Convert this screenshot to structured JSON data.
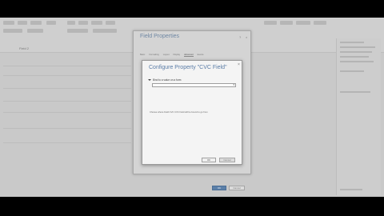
{
  "background_app": {
    "file_label": "Field 2",
    "left_section_labels": [
      "",
      "",
      "",
      ""
    ]
  },
  "field_properties": {
    "title": "Field Properties",
    "close_glyph": "×",
    "help_glyph": "?",
    "tabs": [
      "Basic",
      "Formatting",
      "Layout",
      "Display",
      "Advanced",
      "Events"
    ],
    "active_tab_index": 4,
    "ok_label": "OK",
    "cancel_label": "Cancel"
  },
  "configure_property": {
    "title": "Configure Property \"CVC Field\"",
    "close_glyph": "×",
    "section_label": "Bind to a value on a form",
    "select_value": "",
    "help_text": "Choose where Field CVC CVC Field will be bound to go from",
    "ok_label": "OK",
    "cancel_label": "Cancel"
  },
  "colors": {
    "title_blue": "#5a7ca6",
    "ok_blue": "#5b7fa8",
    "screen_gray": "#c9c9c9"
  }
}
